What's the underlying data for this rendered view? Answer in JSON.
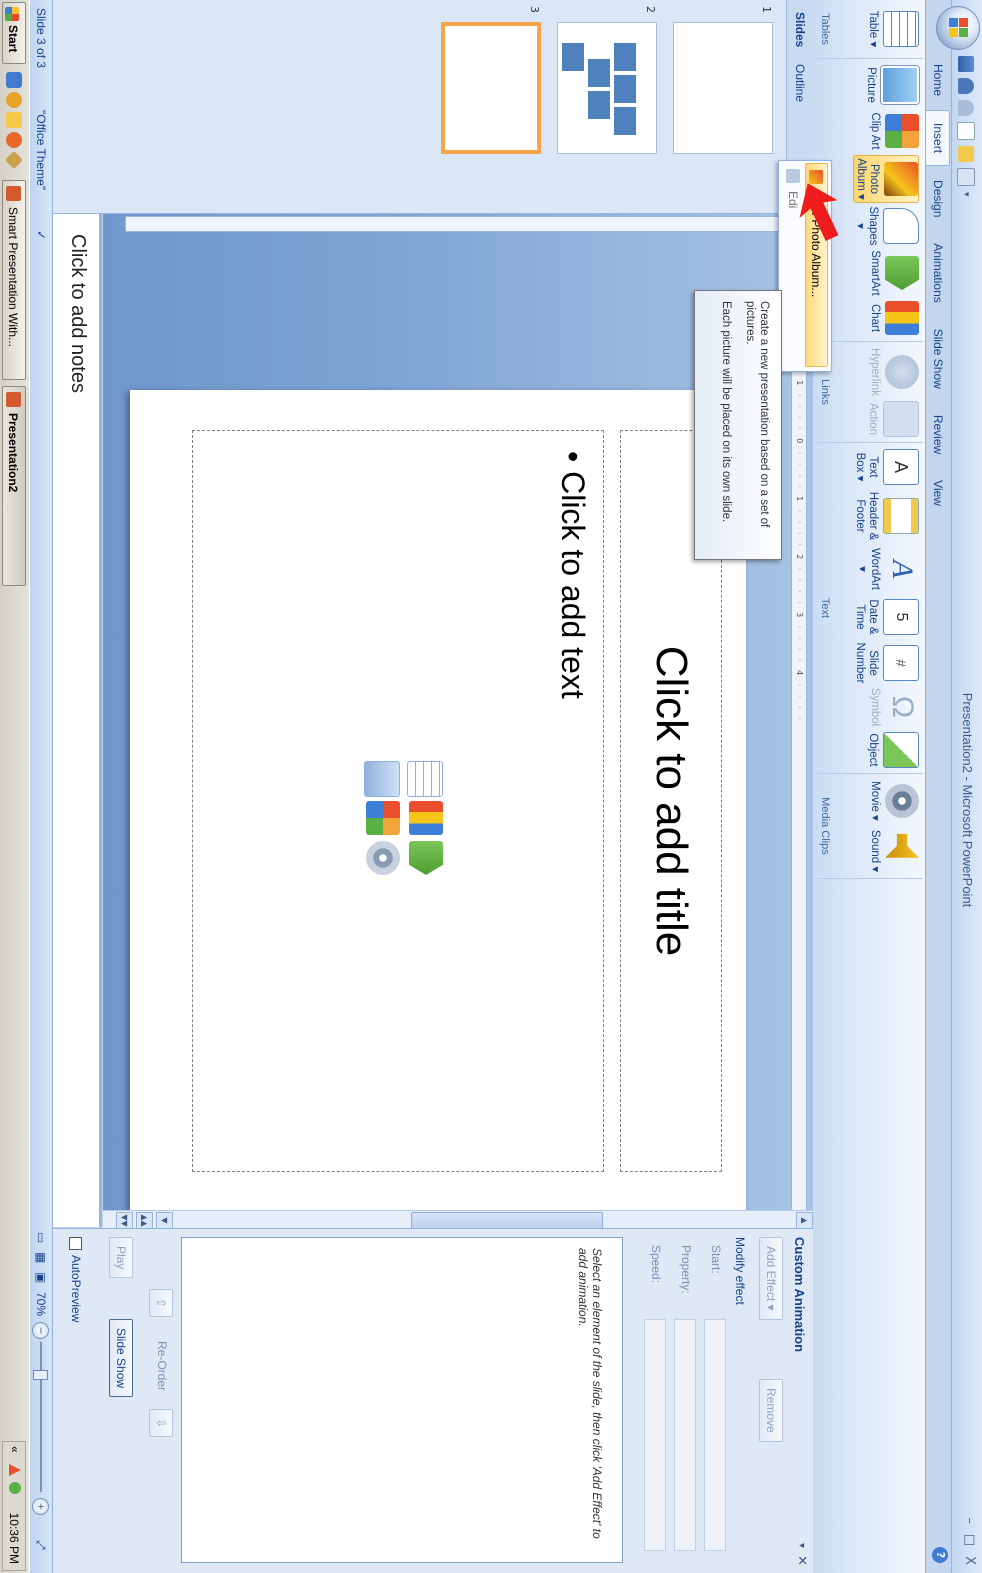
{
  "window": {
    "title": "Presentation2 - Microsoft PowerPoint",
    "controls": {
      "minimize": "–",
      "restore": "□",
      "close": "X"
    }
  },
  "ribbon": {
    "tabs": [
      {
        "label": "Home"
      },
      {
        "label": "Insert",
        "active": true
      },
      {
        "label": "Design"
      },
      {
        "label": "Animations"
      },
      {
        "label": "Slide Show"
      },
      {
        "label": "Review"
      },
      {
        "label": "View"
      }
    ],
    "groups": {
      "tables": {
        "label": "Tables",
        "buttons": [
          {
            "label": "Table ▾",
            "icon": "table-icon"
          }
        ]
      },
      "illustrations": {
        "label": "",
        "buttons": [
          {
            "label": "Picture",
            "icon": "picture-icon"
          },
          {
            "label": "Clip Art",
            "icon": "clip-art-icon"
          },
          {
            "label": "Photo Album ▾",
            "icon": "photo-album-icon",
            "highlighted": true
          },
          {
            "label": "Shapes ▾",
            "icon": "shapes-icon"
          },
          {
            "label": "SmartArt",
            "icon": "smartart-icon"
          },
          {
            "label": "Chart",
            "icon": "chart-icon"
          }
        ]
      },
      "links": {
        "label": "Links",
        "buttons": [
          {
            "label": "Hyperlink",
            "icon": "hyperlink-icon",
            "disabled": true
          },
          {
            "label": "Action",
            "icon": "action-icon",
            "disabled": true
          }
        ]
      },
      "text": {
        "label": "Text",
        "buttons": [
          {
            "label": "Text Box ▾",
            "icon": "text-box-icon"
          },
          {
            "label": "Header & Footer",
            "icon": "header-footer-icon"
          },
          {
            "label": "WordArt ▾",
            "icon": "wordart-icon"
          },
          {
            "label": "Date & Time",
            "icon": "date-time-icon"
          },
          {
            "label": "Slide Number",
            "icon": "slide-number-icon"
          },
          {
            "label": "Symbol",
            "icon": "symbol-icon",
            "disabled": true
          },
          {
            "label": "Object",
            "icon": "object-icon"
          }
        ]
      },
      "media_clips": {
        "label": "Media Clips",
        "buttons": [
          {
            "label": "Movie ▾",
            "icon": "movie-icon"
          },
          {
            "label": "Sound ▾",
            "icon": "sound-icon"
          }
        ]
      }
    }
  },
  "photo_album_menu": {
    "items": [
      {
        "label": "New Photo Album...",
        "icon": "new-photo-album-icon"
      },
      {
        "label": "Edi",
        "icon": "edit-photo-album-icon"
      }
    ],
    "tooltip_line1": "Create a new presentation based on a set of pictures.",
    "tooltip_line2": "Each picture will be placed on its own slide."
  },
  "slides_pane": {
    "tabs": [
      {
        "label": "Slides"
      },
      {
        "label": "Outline"
      }
    ],
    "close": "x",
    "thumbnails": [
      {
        "number": "1"
      },
      {
        "number": "2"
      },
      {
        "number": "3",
        "selected": true
      }
    ]
  },
  "slide": {
    "title_placeholder": "Click to add title",
    "content_placeholder": "Click to add text",
    "bullet": "•"
  },
  "notes": {
    "placeholder": "Click to add notes"
  },
  "task_pane": {
    "title": "Custom Animation",
    "add_effect": "Add Effect ▾",
    "remove": "Remove",
    "modify_label": "Modify effect",
    "fields": [
      {
        "label": "Start:"
      },
      {
        "label": "Property:"
      },
      {
        "label": "Speed:"
      }
    ],
    "hint": "Select an element of the slide, then click 'Add Effect' to add animation.",
    "reorder": "Re-Order",
    "play": "Play",
    "slide_show": "Slide Show",
    "autopreview": "AutoPreview"
  },
  "statusbar": {
    "slide_info": "Slide 3 of 3",
    "theme": "\"Office Theme\"",
    "zoom": "70%"
  },
  "taskbar": {
    "start": "Start",
    "tasks": [
      {
        "label": "Smart Presentation With..."
      },
      {
        "label": "Presentation2",
        "active": true
      }
    ],
    "clock": "10:36 PM",
    "tray_toggle": "«"
  }
}
